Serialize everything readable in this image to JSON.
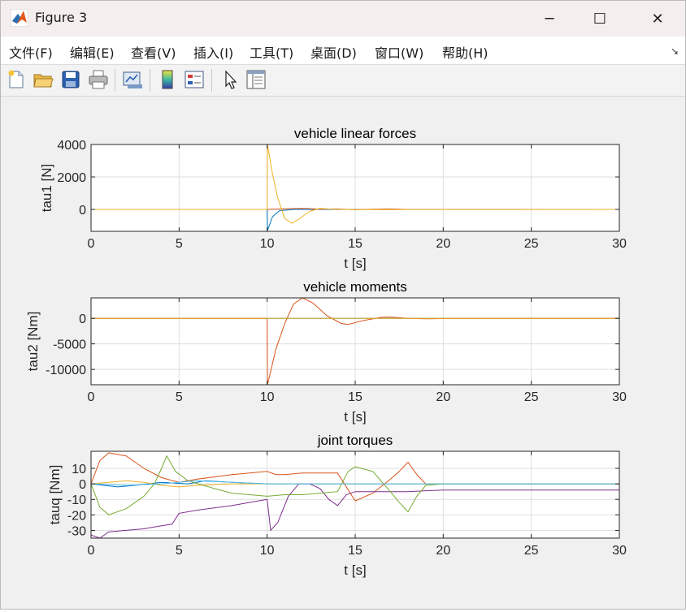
{
  "window": {
    "title": "Figure 3",
    "app_icon": "matlab-logo-icon"
  },
  "window_controls": {
    "minimize": "─",
    "maximize": "☐",
    "close": "✕"
  },
  "menu": {
    "items": [
      {
        "label": "文件(F)"
      },
      {
        "label": "编辑(E)"
      },
      {
        "label": "查看(V)"
      },
      {
        "label": "插入(I)"
      },
      {
        "label": "工具(T)"
      },
      {
        "label": "桌面(D)"
      },
      {
        "label": "窗口(W)"
      },
      {
        "label": "帮助(H)"
      }
    ],
    "dock_arrow": "↘"
  },
  "toolbar": {
    "tools": [
      "new-figure-icon",
      "open-file-icon",
      "save-icon",
      "print-icon",
      "link-plot-icon",
      "insert-colorbar-icon",
      "insert-legend-icon",
      "edit-plot-icon",
      "property-inspector-icon"
    ]
  },
  "colors": {
    "series1": "#0072BD",
    "series2": "#D95319",
    "series3": "#EDB120",
    "series4": "#7E2F8E",
    "series5": "#77AC30",
    "series6": "#4DBEEE"
  },
  "chart_data": [
    {
      "type": "line",
      "title": "vehicle linear forces",
      "xlabel": "t [s]",
      "ylabel": "tau1 [N]",
      "xlim": [
        0,
        30
      ],
      "ylim": [
        -1350,
        4000
      ],
      "xticks": [
        0,
        5,
        10,
        15,
        20,
        25,
        30
      ],
      "yticks": [
        0,
        2000,
        4000
      ],
      "grid": true,
      "series": [
        {
          "color": "#0072BD",
          "points": [
            [
              0,
              0
            ],
            [
              10,
              0
            ],
            [
              10.02,
              -1300
            ],
            [
              10.3,
              -450
            ],
            [
              10.7,
              -80
            ],
            [
              11.5,
              0
            ],
            [
              30,
              0
            ]
          ]
        },
        {
          "color": "#D95319",
          "points": [
            [
              0,
              0
            ],
            [
              10,
              0
            ],
            [
              11,
              40
            ],
            [
              12,
              60
            ],
            [
              13,
              20
            ],
            [
              14,
              30
            ],
            [
              15,
              -20
            ],
            [
              16,
              10
            ],
            [
              17,
              30
            ],
            [
              18,
              0
            ],
            [
              30,
              0
            ]
          ]
        },
        {
          "color": "#EDB120",
          "points": [
            [
              0,
              0
            ],
            [
              10,
              0
            ],
            [
              10.02,
              4000
            ],
            [
              10.3,
              2200
            ],
            [
              10.6,
              700
            ],
            [
              11,
              -550
            ],
            [
              11.4,
              -850
            ],
            [
              11.8,
              -600
            ],
            [
              12.4,
              -120
            ],
            [
              13,
              60
            ],
            [
              13.6,
              20
            ],
            [
              15,
              -10
            ],
            [
              30,
              0
            ]
          ]
        }
      ]
    },
    {
      "type": "line",
      "title": "vehicle moments",
      "xlabel": "t [s]",
      "ylabel": "tau2 [Nm]",
      "xlim": [
        0,
        30
      ],
      "ylim": [
        -13000,
        4000
      ],
      "xticks": [
        0,
        5,
        10,
        15,
        20,
        25,
        30
      ],
      "yticks": [
        0,
        -5000,
        -10000
      ],
      "grid": true,
      "series": [
        {
          "color": "#0072BD",
          "points": [
            [
              0,
              0
            ],
            [
              30,
              0
            ]
          ]
        },
        {
          "color": "#D95319",
          "points": [
            [
              0,
              0
            ],
            [
              10,
              0
            ],
            [
              10.02,
              -13000
            ],
            [
              10.5,
              -6000
            ],
            [
              11,
              -1000
            ],
            [
              11.5,
              2800
            ],
            [
              12,
              4000
            ],
            [
              12.6,
              3000
            ],
            [
              13.4,
              500
            ],
            [
              14.2,
              -1000
            ],
            [
              14.6,
              -1200
            ],
            [
              15.5,
              -400
            ],
            [
              16.5,
              200
            ],
            [
              17,
              250
            ],
            [
              18,
              0
            ],
            [
              19,
              -100
            ],
            [
              21,
              0
            ],
            [
              30,
              0
            ]
          ]
        },
        {
          "color": "#EDB120",
          "points": [
            [
              0,
              0
            ],
            [
              30,
              0
            ]
          ]
        }
      ]
    },
    {
      "type": "line",
      "title": "joint torques",
      "xlabel": "t [s]",
      "ylabel": "tauq [Nm]",
      "xlim": [
        0,
        30
      ],
      "ylim": [
        -35,
        21
      ],
      "xticks": [
        0,
        5,
        10,
        15,
        20,
        25,
        30
      ],
      "yticks": [
        10,
        0,
        -10,
        -20,
        -30
      ],
      "grid": true,
      "series": [
        {
          "color": "#0072BD",
          "points": [
            [
              0,
              0
            ],
            [
              1.5,
              -2
            ],
            [
              2.5,
              -1
            ],
            [
              4,
              1
            ],
            [
              5.5,
              0
            ],
            [
              6.5,
              2
            ],
            [
              8,
              1
            ],
            [
              10,
              0
            ],
            [
              30,
              0
            ]
          ]
        },
        {
          "color": "#D95319",
          "points": [
            [
              0,
              0
            ],
            [
              0.5,
              15
            ],
            [
              1,
              20
            ],
            [
              2,
              18
            ],
            [
              3,
              10
            ],
            [
              4,
              4
            ],
            [
              5,
              1
            ],
            [
              6,
              3
            ],
            [
              8,
              6
            ],
            [
              9,
              7
            ],
            [
              10,
              8
            ],
            [
              10.5,
              6
            ],
            [
              11,
              6
            ],
            [
              12,
              7
            ],
            [
              13,
              7
            ],
            [
              14,
              7
            ],
            [
              15,
              -11
            ],
            [
              16,
              -6
            ],
            [
              17,
              3
            ],
            [
              17.5,
              8
            ],
            [
              18,
              14
            ],
            [
              18.5,
              6
            ],
            [
              19,
              0
            ],
            [
              20,
              0
            ],
            [
              30,
              0
            ]
          ]
        },
        {
          "color": "#EDB120",
          "points": [
            [
              0,
              0
            ],
            [
              1,
              1
            ],
            [
              2,
              2
            ],
            [
              3,
              1
            ],
            [
              4,
              -1
            ],
            [
              5,
              -2
            ],
            [
              6,
              -1
            ],
            [
              8,
              0
            ],
            [
              10,
              0
            ],
            [
              12,
              0
            ],
            [
              14,
              0
            ],
            [
              16,
              0
            ],
            [
              18,
              0
            ],
            [
              30,
              0
            ]
          ]
        },
        {
          "color": "#7E2F8E",
          "points": [
            [
              0,
              -33
            ],
            [
              0.5,
              -35
            ],
            [
              1,
              -31
            ],
            [
              2,
              -30
            ],
            [
              3,
              -29
            ],
            [
              4,
              -27
            ],
            [
              4.6,
              -26
            ],
            [
              5,
              -19
            ],
            [
              6,
              -17
            ],
            [
              8,
              -14
            ],
            [
              9.5,
              -11
            ],
            [
              10,
              -10
            ],
            [
              10.2,
              -30
            ],
            [
              10.6,
              -25
            ],
            [
              11.2,
              -8
            ],
            [
              11.8,
              0
            ],
            [
              12.4,
              0
            ],
            [
              13,
              -3
            ],
            [
              13.5,
              -10
            ],
            [
              14,
              -14
            ],
            [
              14.5,
              -7
            ],
            [
              15,
              -5
            ],
            [
              16,
              -5
            ],
            [
              18,
              -5
            ],
            [
              20,
              -4
            ],
            [
              25,
              -4
            ],
            [
              30,
              -4
            ]
          ]
        },
        {
          "color": "#77AC30",
          "points": [
            [
              0,
              0
            ],
            [
              0.5,
              -15
            ],
            [
              1,
              -20
            ],
            [
              2,
              -16
            ],
            [
              3,
              -8
            ],
            [
              3.6,
              0
            ],
            [
              4,
              10
            ],
            [
              4.3,
              18
            ],
            [
              4.8,
              8
            ],
            [
              5.5,
              2
            ],
            [
              7,
              -3
            ],
            [
              8,
              -6
            ],
            [
              10,
              -8
            ],
            [
              11,
              -7
            ],
            [
              12,
              -7
            ],
            [
              13,
              -6
            ],
            [
              14,
              -5
            ],
            [
              14.6,
              8
            ],
            [
              15,
              11
            ],
            [
              16,
              8
            ],
            [
              17,
              -5
            ],
            [
              17.5,
              -12
            ],
            [
              18,
              -18
            ],
            [
              18.5,
              -8
            ],
            [
              19,
              -1
            ],
            [
              20,
              0
            ],
            [
              30,
              0
            ]
          ]
        },
        {
          "color": "#4DBEEE",
          "points": [
            [
              0,
              0
            ],
            [
              2,
              -1
            ],
            [
              4,
              0
            ],
            [
              6,
              2
            ],
            [
              8,
              1
            ],
            [
              10,
              0
            ],
            [
              30,
              0
            ]
          ]
        }
      ]
    }
  ]
}
